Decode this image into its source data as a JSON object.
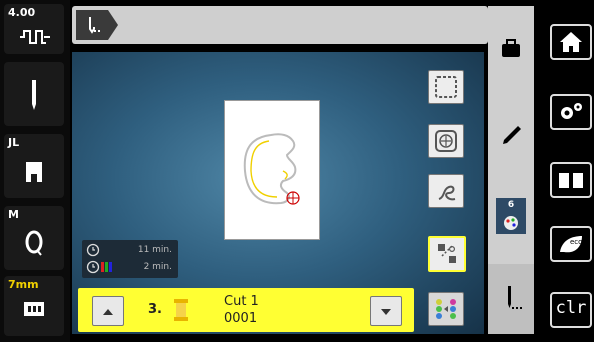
{
  "left_rail": {
    "stitch_width": "4.00",
    "needle_label": "JL",
    "bobbin_label": "M",
    "stitch_length": "7mm"
  },
  "canvas": {
    "time_total": "11 min.",
    "time_color": "2 min."
  },
  "bottom_bar": {
    "color_index": "3.",
    "color_name": "Cut 1",
    "color_code": "0001"
  },
  "mid_panel": {
    "color_count": "6"
  },
  "right_rail": {
    "clr_label": "clr",
    "eco_label": "eco"
  },
  "colors": {
    "accent_yellow": "#ffff33",
    "stitch_yellow": "#f0d000",
    "panel_gray": "#cfcfcf"
  }
}
